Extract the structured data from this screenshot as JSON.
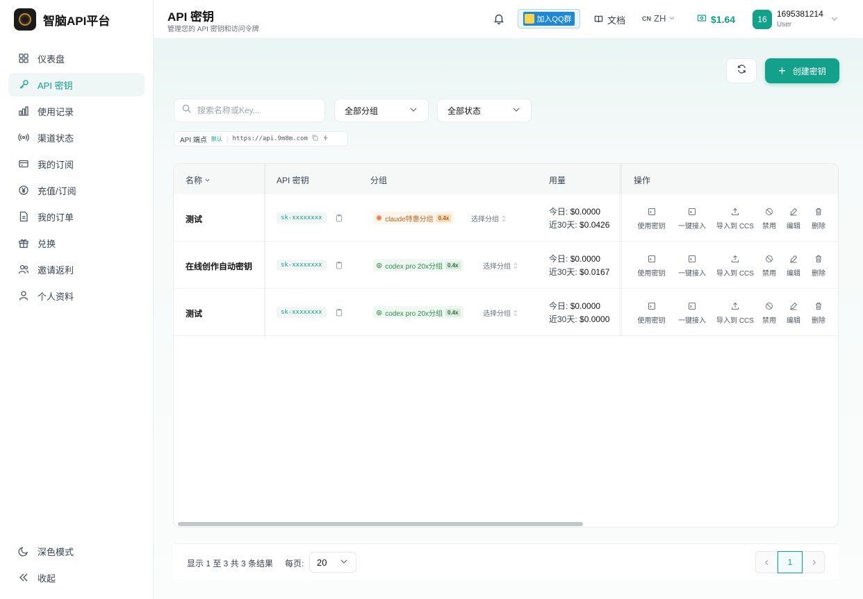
{
  "brand": {
    "name": "智脑API平台"
  },
  "sidebar": {
    "items": [
      {
        "label": "仪表盘",
        "icon": "dashboard-icon"
      },
      {
        "label": "API 密钥",
        "icon": "key-icon",
        "active": true
      },
      {
        "label": "使用记录",
        "icon": "bar-chart-icon"
      },
      {
        "label": "渠道状态",
        "icon": "signal-icon"
      },
      {
        "label": "我的订阅",
        "icon": "card-icon"
      },
      {
        "label": "充值/订阅",
        "icon": "yen-icon"
      },
      {
        "label": "我的订单",
        "icon": "document-icon"
      },
      {
        "label": "兑换",
        "icon": "gift-icon"
      },
      {
        "label": "邀请返利",
        "icon": "users-icon"
      },
      {
        "label": "个人资料",
        "icon": "user-icon"
      }
    ],
    "dark_mode_label": "深色模式",
    "collapse_label": "收起"
  },
  "header": {
    "title": "API 密钥",
    "subtitle": "管理您的 API 密钥和访问令牌",
    "qq_label": "加入QQ群",
    "docs_label": "文档",
    "lang_code": "CN",
    "lang_label": "ZH",
    "balance": "$1.64",
    "avatar_text": "16",
    "user_name": "1695381214",
    "user_role": "User"
  },
  "toolbar": {
    "create_label": "创建密钥"
  },
  "filters": {
    "search_placeholder": "搜索名称或Key...",
    "group_select": "全部分组",
    "status_select": "全部状态"
  },
  "endpoint": {
    "label": "API 端点",
    "default_tag": "默认",
    "url": "https://api.9m8m.com"
  },
  "table": {
    "headers": {
      "name": "名称",
      "key": "API 密钥",
      "group": "分组",
      "usage": "用量",
      "actions": "操作"
    },
    "action_labels": [
      "使用密钥",
      "一键接入",
      "导入到 CCS",
      "禁用",
      "编辑",
      "删除"
    ],
    "pick_group_label": "选择分组",
    "today_label": "今日:",
    "last30_label": "近30天:",
    "rows": [
      {
        "name": "测试",
        "key": "sk-xxxxxxxx",
        "group": "claude特惠分组",
        "group_type": "claude",
        "ratio": "0.4x",
        "today": "$0.0000",
        "last30": "$0.0426"
      },
      {
        "name": "在线创作自动密钥",
        "key": "sk-xxxxxxxx",
        "group": "codex pro 20x分组",
        "group_type": "codex",
        "ratio": "0.4x",
        "today": "$0.0000",
        "last30": "$0.0167"
      },
      {
        "name": "测试",
        "key": "sk-xxxxxxxx",
        "group": "codex pro 20x分组",
        "group_type": "codex",
        "ratio": "0.4x",
        "today": "$0.0000",
        "last30": "$0.0000"
      }
    ]
  },
  "pagination": {
    "info": "显示 1 至 3 共 3 条结果",
    "per_page_label": "每页:",
    "per_page": "20",
    "current_page": "1"
  },
  "colors": {
    "accent": "#13a18c",
    "claude": "#c2692a",
    "codex": "#2f8a4c"
  }
}
